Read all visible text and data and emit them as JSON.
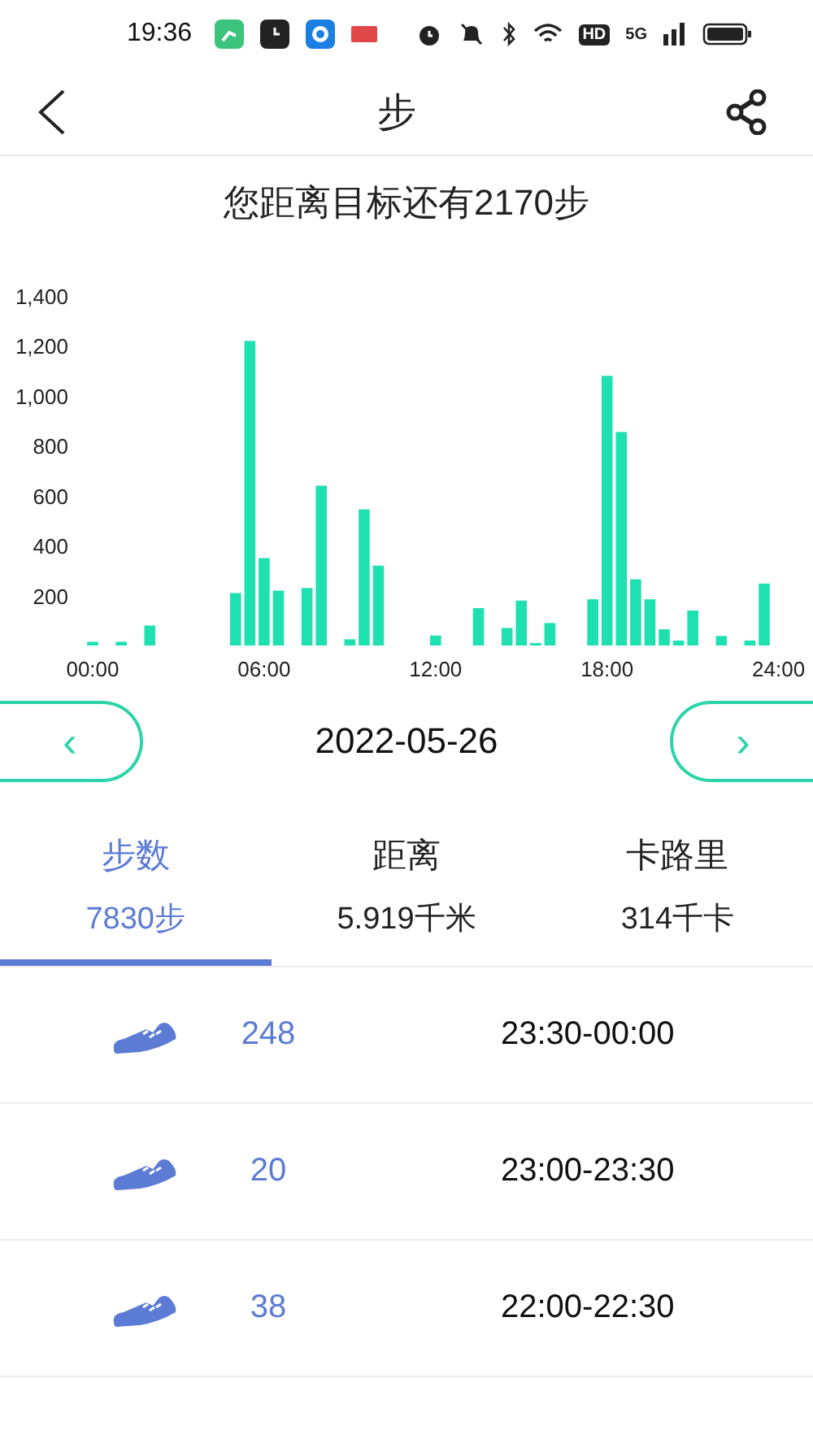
{
  "status_bar": {
    "time": "19:36",
    "hd": "HD",
    "network": "5G"
  },
  "header": {
    "title": "步"
  },
  "goal_text": "您距离目标还有2170步",
  "chart": {
    "chart_data": {
      "type": "bar",
      "x": [
        0,
        1,
        2,
        5,
        5.5,
        6,
        6.5,
        7.5,
        8,
        9,
        9.5,
        10,
        12,
        13.5,
        14.5,
        15,
        15.5,
        16,
        17.5,
        18,
        18.5,
        19,
        19.5,
        20,
        20.5,
        21,
        22,
        23,
        23.5
      ],
      "xlim": [
        0,
        24
      ],
      "series": [
        {
          "color": "#1fe0b0",
          "values": [
            15,
            15,
            80,
            210,
            1220,
            350,
            220,
            230,
            640,
            25,
            545,
            320,
            40,
            150,
            70,
            180,
            10,
            90,
            185,
            1080,
            855,
            265,
            185,
            65,
            20,
            140,
            38,
            20,
            248
          ]
        }
      ],
      "ylim": [
        0,
        1400
      ],
      "yticks": [
        {
          "value": 200,
          "label": "200"
        },
        {
          "value": 400,
          "label": "400"
        },
        {
          "value": 600,
          "label": "600"
        },
        {
          "value": 800,
          "label": "800"
        },
        {
          "value": 1000,
          "label": "1,000"
        },
        {
          "value": 1200,
          "label": "1,200"
        },
        {
          "value": 1400,
          "label": "1,400"
        }
      ],
      "xticks": [
        {
          "value": 0,
          "label": "00:00"
        },
        {
          "value": 6,
          "label": "06:00"
        },
        {
          "value": 12,
          "label": "12:00"
        },
        {
          "value": 18,
          "label": "18:00"
        },
        {
          "value": 24,
          "label": "24:00"
        }
      ]
    }
  },
  "date_nav": {
    "prev": "‹",
    "date": "2022-05-26",
    "next": "›"
  },
  "tabs": [
    {
      "label": "步数",
      "value": "7830步",
      "selected": true
    },
    {
      "label": "距离",
      "value": "5.919千米",
      "selected": false
    },
    {
      "label": "卡路里",
      "value": "314千卡",
      "selected": false
    }
  ],
  "records": [
    {
      "steps": "248",
      "time": "23:30-00:00"
    },
    {
      "steps": "20",
      "time": "23:00-23:30"
    },
    {
      "steps": "38",
      "time": "22:00-22:30"
    }
  ]
}
